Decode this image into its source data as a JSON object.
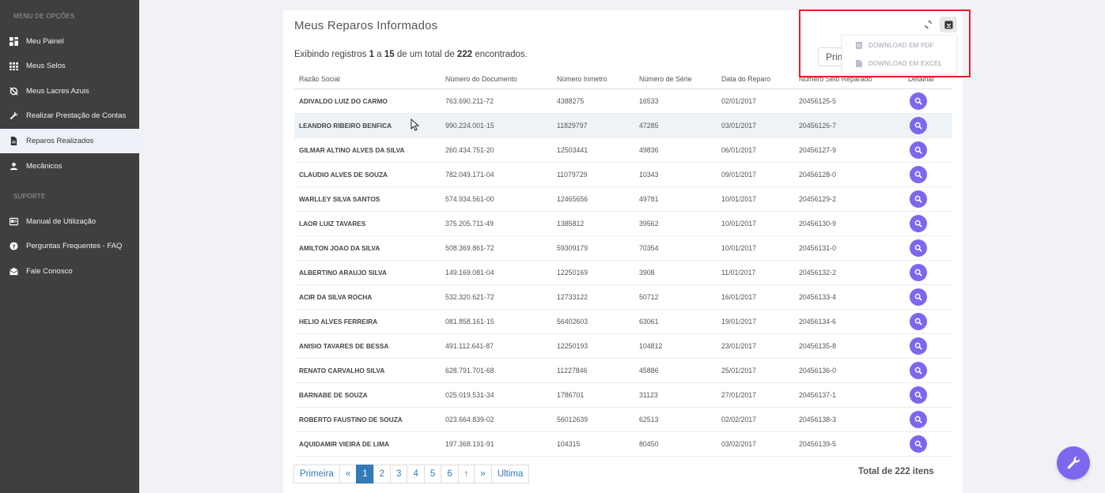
{
  "sidebar": {
    "menu_title": "MENU DE OPÇÕES",
    "support_title": "SUPORTE",
    "items": [
      {
        "label": "Meu Painel",
        "icon": "dashboard-icon"
      },
      {
        "label": "Meus Selos",
        "icon": "grid-icon"
      },
      {
        "label": "Meus Lacres Azuis",
        "icon": "seal-off-icon"
      },
      {
        "label": "Realizar Prestação de Contas",
        "icon": "wrench-icon"
      },
      {
        "label": "Reparos Realizados",
        "icon": "document-icon",
        "active": true
      },
      {
        "label": "Mecânicos",
        "icon": "user-icon"
      }
    ],
    "support_items": [
      {
        "label": "Manual de Utilização",
        "icon": "book-icon"
      },
      {
        "label": "Perguntas Frequentes - FAQ",
        "icon": "help-icon"
      },
      {
        "label": "Fale Conosco",
        "icon": "mail-icon"
      }
    ]
  },
  "main": {
    "title": "Meus Reparos Informados",
    "records_prefix": "Exibindo registros",
    "records_from": "1",
    "records_a": "a",
    "records_to": "15",
    "records_mid": "de um total de",
    "records_total": "222",
    "records_suffix": "encontrados.",
    "print_label": "Prin",
    "export_menu": {
      "pdf": "DOWNLOAD EM PDF",
      "excel": "DOWNLOAD EM EXCEL"
    },
    "columns": [
      "Razão Social",
      "Número do Documento",
      "Número Inmetro",
      "Número de Série",
      "Data do Reparo",
      "Número Selo Reparado",
      "Detalhar"
    ],
    "rows": [
      [
        "ADIVALDO LUIZ DO CARMO",
        "763.690.211-72",
        "4388275",
        "16533",
        "02/01/2017",
        "20456125-5"
      ],
      [
        "LEANDRO RIBEIRO BENFICA",
        "990.224.001-15",
        "11829797",
        "47285",
        "03/01/2017",
        "20456126-7"
      ],
      [
        "GILMAR ALTINO ALVES DA SILVA",
        "260.434.751-20",
        "12503441",
        "49836",
        "06/01/2017",
        "20456127-9"
      ],
      [
        "CLAUDIO ALVES DE SOUZA",
        "782.049.171-04",
        "11079729",
        "10343",
        "09/01/2017",
        "20456128-0"
      ],
      [
        "WARLLEY SILVA SANTOS",
        "574.934.561-00",
        "12465656",
        "49781",
        "10/01/2017",
        "20456129-2"
      ],
      [
        "LAOR LUIZ TAVARES",
        "375.205.711-49",
        "1385812",
        "39562",
        "10/01/2017",
        "20456130-9"
      ],
      [
        "AMILTON JOAO DA SILVA",
        "508.369.861-72",
        "59309179",
        "70354",
        "10/01/2017",
        "20456131-0"
      ],
      [
        "ALBERTINO ARAUJO SILVA",
        "149.169.081-04",
        "12250169",
        "3908",
        "11/01/2017",
        "20456132-2"
      ],
      [
        "ACIR DA SILVA ROCHA",
        "532.320.621-72",
        "12733122",
        "50712",
        "16/01/2017",
        "20456133-4"
      ],
      [
        "HELIO ALVES FERREIRA",
        "081.858.161-15",
        "56402603",
        "63061",
        "19/01/2017",
        "20456134-6"
      ],
      [
        "ANISIO TAVARES DE BESSA",
        "491.112.641-87",
        "12250193",
        "104812",
        "23/01/2017",
        "20456135-8"
      ],
      [
        "RENATO CARVALHO SILVA",
        "628.791.701-68",
        "11227846",
        "45886",
        "25/01/2017",
        "20456136-0"
      ],
      [
        "BARNABE DE SOUZA",
        "025.019.531-34",
        "1786701",
        "31123",
        "27/01/2017",
        "20456137-1"
      ],
      [
        "ROBERTO FAUSTINO DE SOUZA",
        "023.664.839-02",
        "56012639",
        "62513",
        "02/02/2017",
        "20456138-3"
      ],
      [
        "AQUIDAMIR VIEIRA DE LIMA",
        "197.368.191-91",
        "104315",
        "80450",
        "03/02/2017",
        "20456139-5"
      ]
    ],
    "highlighted_row": 1,
    "pagination": [
      "Primeira",
      "«",
      "1",
      "2",
      "3",
      "4",
      "5",
      "6",
      "↑",
      "»",
      "Ultima"
    ],
    "current_page": "1",
    "total_label": "Total de 222 itens"
  },
  "colors": {
    "accent": "#7b68ee",
    "sidebar_bg": "#3f3f3f",
    "page_active": "#337ab7",
    "highlight_box": "#e3202b"
  }
}
